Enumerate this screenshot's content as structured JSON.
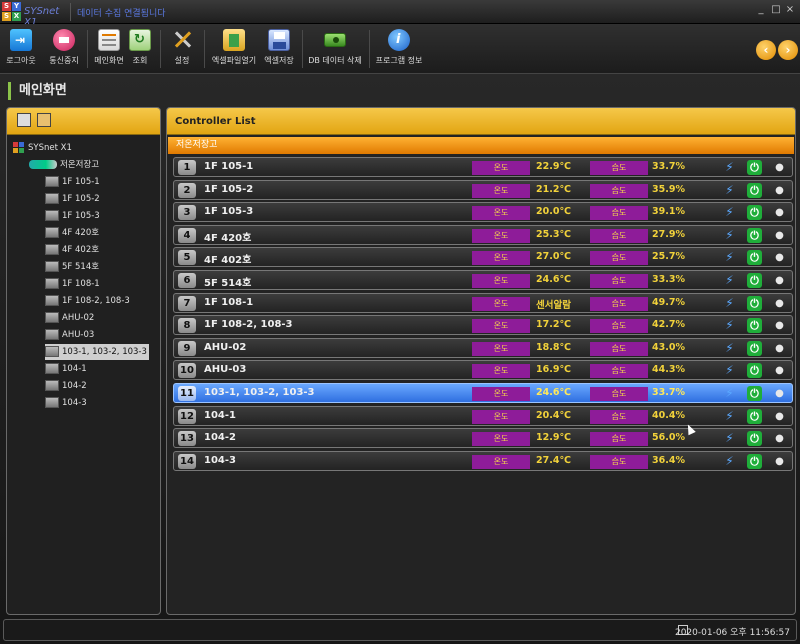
{
  "titlebar": {
    "brand": "SYSnet X1",
    "status": "데이터 수집 연결됨니다",
    "controls": [
      "_",
      "□",
      "×"
    ]
  },
  "toolbar": {
    "buttons": [
      {
        "label": "로그아웃",
        "icon": "logout-icon"
      },
      {
        "label": "통신중지",
        "icon": "stop-comm-icon"
      },
      {
        "label": "메인화면",
        "icon": "main-screen-icon"
      },
      {
        "label": "조회",
        "icon": "search-icon"
      },
      {
        "label": "설정",
        "icon": "settings-icon"
      },
      {
        "label": "엑셀파일열기",
        "icon": "excel-open-icon"
      },
      {
        "label": "엑셀저장",
        "icon": "excel-save-icon"
      },
      {
        "label": "DB 데이터 삭제",
        "icon": "db-delete-icon"
      },
      {
        "label": "프로그램 정보",
        "icon": "info-icon"
      }
    ]
  },
  "page": {
    "title": "메인화면"
  },
  "tree": {
    "root": "SYSnet X1",
    "group": "저온저장고",
    "items": [
      "1F 105-1",
      "1F 105-2",
      "1F 105-3",
      "4F 420호",
      "4F 402호",
      "5F 514호",
      "1F 108-1",
      "1F 108-2, 108-3",
      "AHU-02",
      "AHU-03",
      "103-1, 103-2, 103-3",
      "104-1",
      "104-2",
      "104-3"
    ],
    "selected_index": 10
  },
  "controller_list": {
    "title": "Controller List",
    "group": "저온저장고",
    "temp_label": "온도",
    "hum_label": "습도",
    "rows": [
      {
        "num": "1",
        "name": "1F 105-1",
        "temp": "22.9℃",
        "hum": "33.7%"
      },
      {
        "num": "2",
        "name": "1F 105-2",
        "temp": "21.2℃",
        "hum": "35.9%"
      },
      {
        "num": "3",
        "name": "1F 105-3",
        "temp": "20.0℃",
        "hum": "39.1%"
      },
      {
        "num": "4",
        "name": "4F 420호",
        "temp": "25.3℃",
        "hum": "27.9%"
      },
      {
        "num": "5",
        "name": "4F 402호",
        "temp": "27.0℃",
        "hum": "25.7%"
      },
      {
        "num": "6",
        "name": "5F 514호",
        "temp": "24.6℃",
        "hum": "33.3%"
      },
      {
        "num": "7",
        "name": "1F 108-1",
        "temp": "센서알람",
        "hum": "49.7%"
      },
      {
        "num": "8",
        "name": "1F 108-2, 108-3",
        "temp": "17.2℃",
        "hum": "42.7%"
      },
      {
        "num": "9",
        "name": "AHU-02",
        "temp": "18.8℃",
        "hum": "43.0%"
      },
      {
        "num": "10",
        "name": "AHU-03",
        "temp": "16.9℃",
        "hum": "44.3%"
      },
      {
        "num": "11",
        "name": "103-1, 103-2, 103-3",
        "temp": "24.6℃",
        "hum": "33.7%"
      },
      {
        "num": "12",
        "name": "104-1",
        "temp": "20.4℃",
        "hum": "40.4%"
      },
      {
        "num": "13",
        "name": "104-2",
        "temp": "12.9℃",
        "hum": "56.0%"
      },
      {
        "num": "14",
        "name": "104-3",
        "temp": "27.4℃",
        "hum": "36.4%"
      }
    ],
    "selected_index": 10,
    "row_icons": [
      "plug-icon",
      "power-icon",
      "person-icon"
    ]
  },
  "status": {
    "datetime": "2020-01-06 오후 11:56:57"
  },
  "colors": {
    "header_gold": "#e2a512",
    "group_orange": "#e07a00",
    "tag_purple": "#8e1c99",
    "value_yellow": "#f2d23a",
    "selected_blue": "#2f6fe0"
  }
}
